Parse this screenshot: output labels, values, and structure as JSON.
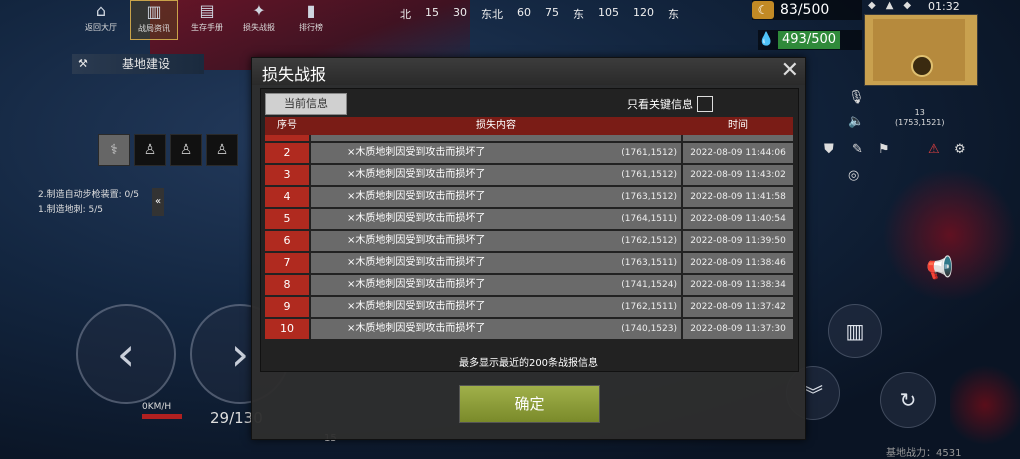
{
  "top_nav": [
    {
      "label": "返回大厅",
      "icon": "home-icon",
      "glyph": "⌂"
    },
    {
      "label": "战局资讯",
      "icon": "news-icon",
      "glyph": "▥"
    },
    {
      "label": "生存手册",
      "icon": "book-icon",
      "glyph": "▤"
    },
    {
      "label": "损失战报",
      "icon": "battle-report-icon",
      "glyph": "✦"
    },
    {
      "label": "排行榜",
      "icon": "leaderboard-icon",
      "glyph": "▮"
    }
  ],
  "compass": [
    "北",
    "15",
    "30",
    "东北",
    "60",
    "75",
    "东",
    "105",
    "120",
    "东"
  ],
  "resources": {
    "supply": "83/500",
    "water": "493/500"
  },
  "clock": "01:32",
  "map": {
    "value": "13",
    "coords": "(1753,1521)"
  },
  "base_build": "基地建设",
  "quests": [
    "2.制造自动步枪装置: 0/5",
    "1.制造地刺: 5/5"
  ],
  "speed": "0KM/H",
  "ammo": "29/130",
  "base_strength": "基地战力：4531",
  "bottom_scale": "15",
  "dialog": {
    "title": "损失战报",
    "tab_current": "当前信息",
    "key_info": "只看关键信息",
    "headers": {
      "index": "序号",
      "content": "损失内容",
      "time": "时间"
    },
    "rows": [
      {
        "n": "2",
        "content": "×木质地刺因受到攻击而损坏了",
        "pos": "(1761,1512)",
        "time": "2022-08-09 11:44:06"
      },
      {
        "n": "3",
        "content": "×木质地刺因受到攻击而损坏了",
        "pos": "(1761,1512)",
        "time": "2022-08-09 11:43:02"
      },
      {
        "n": "4",
        "content": "×木质地刺因受到攻击而损坏了",
        "pos": "(1763,1512)",
        "time": "2022-08-09 11:41:58"
      },
      {
        "n": "5",
        "content": "×木质地刺因受到攻击而损坏了",
        "pos": "(1764,1511)",
        "time": "2022-08-09 11:40:54"
      },
      {
        "n": "6",
        "content": "×木质地刺因受到攻击而损坏了",
        "pos": "(1762,1512)",
        "time": "2022-08-09 11:39:50"
      },
      {
        "n": "7",
        "content": "×木质地刺因受到攻击而损坏了",
        "pos": "(1763,1511)",
        "time": "2022-08-09 11:38:46"
      },
      {
        "n": "8",
        "content": "×木质地刺因受到攻击而损坏了",
        "pos": "(1741,1524)",
        "time": "2022-08-09 11:38:34"
      },
      {
        "n": "9",
        "content": "×木质地刺因受到攻击而损坏了",
        "pos": "(1762,1511)",
        "time": "2022-08-09 11:37:42"
      },
      {
        "n": "10",
        "content": "×木质地刺因受到攻击而损坏了",
        "pos": "(1740,1523)",
        "time": "2022-08-09 11:37:30"
      }
    ],
    "footer_note": "最多显示最近的200条战报信息",
    "confirm": "确定"
  }
}
